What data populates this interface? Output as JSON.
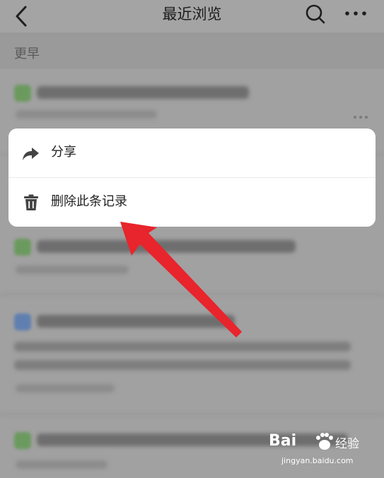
{
  "header": {
    "title": "最近浏览",
    "back_icon": "chevron-left-icon",
    "search_icon": "search-icon",
    "more_icon": "more-horizontal-icon"
  },
  "section": {
    "title": "更早"
  },
  "popup_menu": {
    "items": [
      {
        "label": "分享",
        "icon": "share-arrow-icon"
      },
      {
        "label": "删除此条记录",
        "icon": "trash-icon"
      }
    ]
  },
  "annotation": {
    "color": "#e8242c"
  },
  "watermark": {
    "brand": "Bai",
    "brand_suffix": "经验",
    "url": "jingyan.baidu.com"
  },
  "colors": {
    "overlay_bg": "#9a9a9a",
    "popup_bg": "#ffffff",
    "green_icon": "#5aa84a",
    "blue_icon": "#3a78c8"
  }
}
